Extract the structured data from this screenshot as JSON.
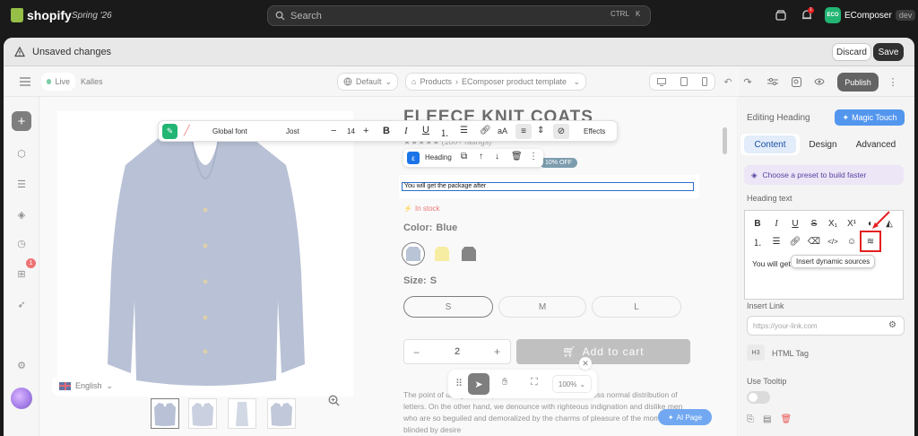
{
  "topbar": {
    "brand": "shopify",
    "edition": "Spring '26",
    "search_placeholder": "Search",
    "shortcut_ctrl": "CTRL",
    "shortcut_key": "K",
    "notif_count": "1",
    "store_badge": "ECO",
    "store_name": "EComposer",
    "store_env": "dev"
  },
  "savebar": {
    "title": "Unsaved changes",
    "discard": "Discard",
    "save": "Save"
  },
  "editor": {
    "status": "Live",
    "theme": "Kalles",
    "template_select": "Default",
    "breadcrumb_root": "Products",
    "breadcrumb_page": "EComposer product template",
    "publish": "Publish"
  },
  "lsidebar": {
    "badge": "1"
  },
  "toolbar": {
    "font": "Global font",
    "font_name": "Jost",
    "size": "14",
    "effects": "Effects",
    "heading_tag": "Heading"
  },
  "product": {
    "title": "FLEECE KNIT COATS",
    "ratings": "(100+ ratings)",
    "sale_badge": "10% OFF",
    "heading_text": "You will get the package after",
    "stock": "In stock",
    "color_label": "Color:",
    "color_value": "Blue",
    "size_label": "Size:",
    "size_value": "S",
    "sizes": [
      "S",
      "M",
      "L"
    ],
    "qty": "2",
    "minus": "−",
    "plus": "+",
    "add_to_cart": "Add to cart",
    "desc1": "The point of using Lorem Ipsum is that it has a more-or-less normal distribution of",
    "desc2": "letters. On the other hand, we denounce with righteous indignation and dislike men",
    "desc3": "who are so beguiled and demoralized by the charms of pleasure of the moment, so",
    "desc4": "blinded by desire"
  },
  "language": "English",
  "bottom": {
    "zoom": "100%",
    "ai_page": "AI Page"
  },
  "panel": {
    "title": "Editing Heading",
    "magic": "Magic Touch",
    "tabs": [
      "Content",
      "Design",
      "Advanced"
    ],
    "preset": "Choose a preset to build faster",
    "heading_text_label": "Heading text",
    "editor_text": "You will get",
    "tooltip": "Insert dynamic sources",
    "insert_link": "Insert Link",
    "link_placeholder": "https://your-link.com",
    "html_tag_short": "H3",
    "html_tag": "HTML Tag",
    "tooltip_label": "Use Tooltip"
  },
  "colors": {
    "accent": "#2c6ecb",
    "magic": "#1a73e8",
    "highlight": "#e32020",
    "swatch_blue": "#8ea0bf",
    "swatch_yellow": "#f2e36a",
    "swatch_black": "#3a3a3a",
    "sweater": "#8d9bbb"
  }
}
